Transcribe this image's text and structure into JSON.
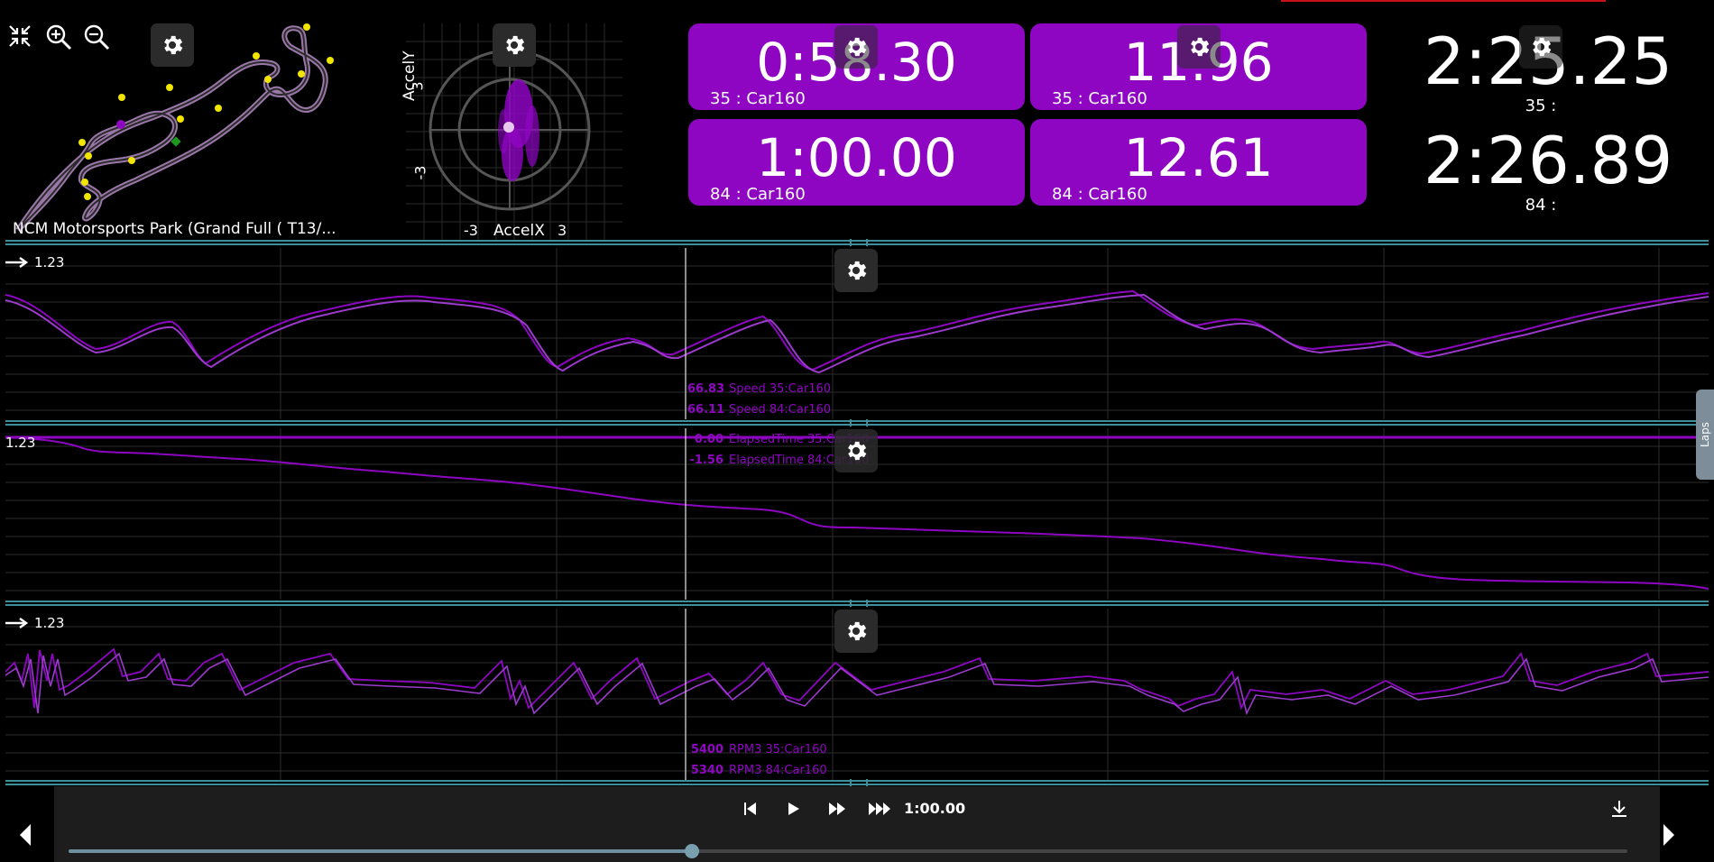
{
  "toolbar": {
    "fit_icon": "compress-arrows-icon",
    "zoom_in_icon": "zoom-in-icon",
    "zoom_out_icon": "zoom-out-icon"
  },
  "map": {
    "track_name": "NCM Motorsports Park (Grand Full ( T13/..."
  },
  "gg_plot": {
    "x_label": "AccelX",
    "y_label": "AccelY",
    "x_min": "-3",
    "x_max": "3",
    "y_min": "-3",
    "y_max": "3"
  },
  "tiles": [
    {
      "value": "0:58.30",
      "label": "35 : Car160"
    },
    {
      "value": "11.96",
      "label": "35 : Car160"
    },
    {
      "value": "1:00.00",
      "label": "84 : Car160"
    },
    {
      "value": "12.61",
      "label": "84 : Car160"
    }
  ],
  "lap_times": [
    {
      "time": "2:25.25",
      "lap": "35 :"
    },
    {
      "time": "2:26.89",
      "lap": "84 :"
    }
  ],
  "panels": {
    "speed": {
      "scale": "1.23",
      "readouts": [
        {
          "value": "66.83",
          "label": "Speed 35:Car160"
        },
        {
          "value": "66.11",
          "label": "Speed 84:Car160"
        }
      ]
    },
    "elapsed": {
      "scale": "1.23",
      "readouts": [
        {
          "value": "0.00",
          "label": "ElapsedTime 35:Car160"
        },
        {
          "value": "-1.56",
          "label": "ElapsedTime 84:Car160"
        }
      ]
    },
    "rpm": {
      "scale": "1.23",
      "readouts": [
        {
          "value": "5400",
          "label": "RPM3 35:Car160"
        },
        {
          "value": "5340",
          "label": "RPM3 84:Car160"
        }
      ]
    }
  },
  "side_tab": {
    "label": "Laps"
  },
  "playback": {
    "time": "1:00.00",
    "progress": 0.4
  }
}
